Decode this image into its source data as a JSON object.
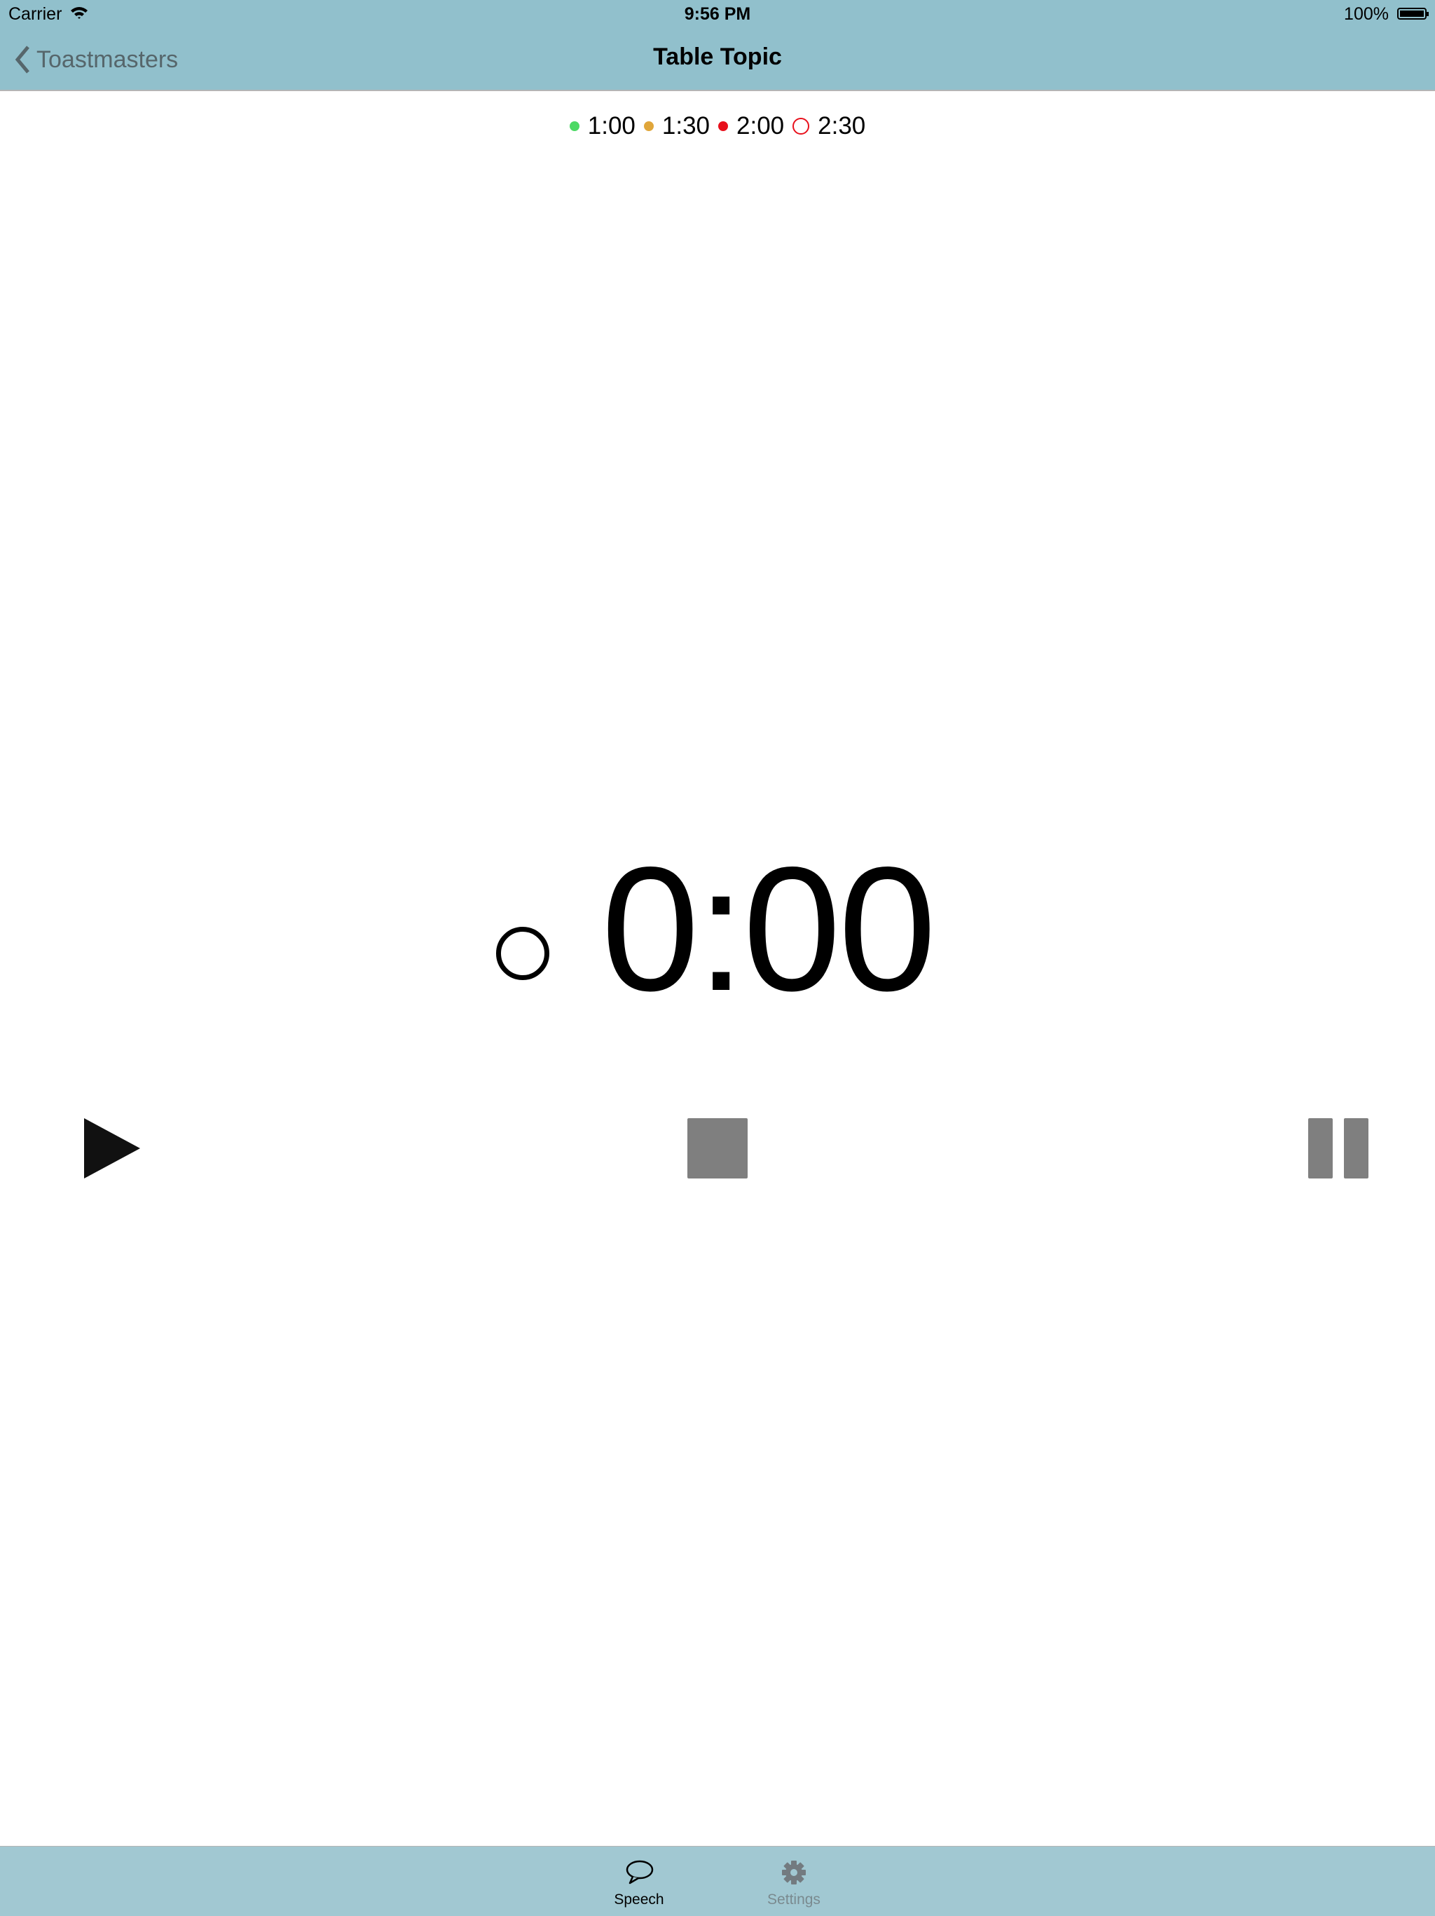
{
  "status_bar": {
    "carrier": "Carrier",
    "time": "9:56 PM",
    "battery": "100%"
  },
  "nav": {
    "back_label": "Toastmasters",
    "title": "Table Topic"
  },
  "milestones": [
    {
      "time": "1:00",
      "color": "#4cd964",
      "style": "filled"
    },
    {
      "time": "1:30",
      "color": "#e0a63a",
      "style": "filled"
    },
    {
      "time": "2:00",
      "color": "#e8101c",
      "style": "filled"
    },
    {
      "time": "2:30",
      "color": "#e8101c",
      "style": "outline"
    }
  ],
  "timer": {
    "value": "0:00"
  },
  "tabs": [
    {
      "label": "Speech",
      "icon": "speech-bubble-icon",
      "selected": true
    },
    {
      "label": "Settings",
      "icon": "gear-icon",
      "selected": false
    }
  ]
}
